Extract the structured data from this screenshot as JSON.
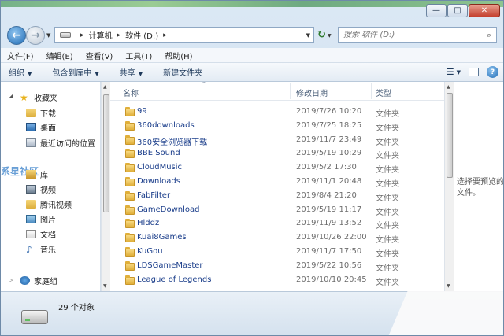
{
  "window": {
    "controls": {
      "minimize": "—",
      "maximize": "□",
      "close": "✕"
    }
  },
  "address": {
    "crumbs": [
      "计算机",
      "软件 (D:)"
    ],
    "search_placeholder": "搜索 软件 (D:)"
  },
  "menu": [
    "文件(F)",
    "编辑(E)",
    "查看(V)",
    "工具(T)",
    "帮助(H)"
  ],
  "toolbar": {
    "organize": "组织",
    "include_in_library": "包含到库中",
    "share": "共享",
    "new_folder": "新建文件夹"
  },
  "nav": {
    "favorites": "收藏夹",
    "downloads": "下载",
    "desktop": "桌面",
    "recent": "最近访问的位置",
    "libraries": "库",
    "videos": "视频",
    "tencent_video": "腾讯视频",
    "pictures": "图片",
    "documents": "文档",
    "music": "音乐",
    "homegroup": "家庭组",
    "watermark": "系星社区"
  },
  "columns": {
    "name": "名称",
    "date": "修改日期",
    "type": "类型"
  },
  "files": [
    {
      "name": "99",
      "date": "2019/7/26 10:20",
      "type": "文件夹"
    },
    {
      "name": "360downloads",
      "date": "2019/7/25 18:25",
      "type": "文件夹"
    },
    {
      "name": "360安全浏览器下载",
      "date": "2019/11/7 23:49",
      "type": "文件夹"
    },
    {
      "name": "BBE Sound",
      "date": "2019/5/19 10:29",
      "type": "文件夹"
    },
    {
      "name": "CloudMusic",
      "date": "2019/5/2 17:30",
      "type": "文件夹"
    },
    {
      "name": "Downloads",
      "date": "2019/11/1 20:48",
      "type": "文件夹"
    },
    {
      "name": "FabFilter",
      "date": "2019/8/4 21:20",
      "type": "文件夹"
    },
    {
      "name": "GameDownload",
      "date": "2019/5/19 11:17",
      "type": "文件夹"
    },
    {
      "name": "Hlddz",
      "date": "2019/11/9 13:52",
      "type": "文件夹"
    },
    {
      "name": "Kuai8Games",
      "date": "2019/10/26 22:00",
      "type": "文件夹"
    },
    {
      "name": "KuGou",
      "date": "2019/11/7 17:50",
      "type": "文件夹"
    },
    {
      "name": "LDSGameMaster",
      "date": "2019/5/22 10:56",
      "type": "文件夹"
    },
    {
      "name": "League of Legends",
      "date": "2019/10/10 20:45",
      "type": "文件夹"
    }
  ],
  "preview": {
    "text": "选择要预览的文件。"
  },
  "status": {
    "count": "29 个对象"
  },
  "colors": {
    "link": "#1a3d8a",
    "accent": "#1f6bb5"
  }
}
